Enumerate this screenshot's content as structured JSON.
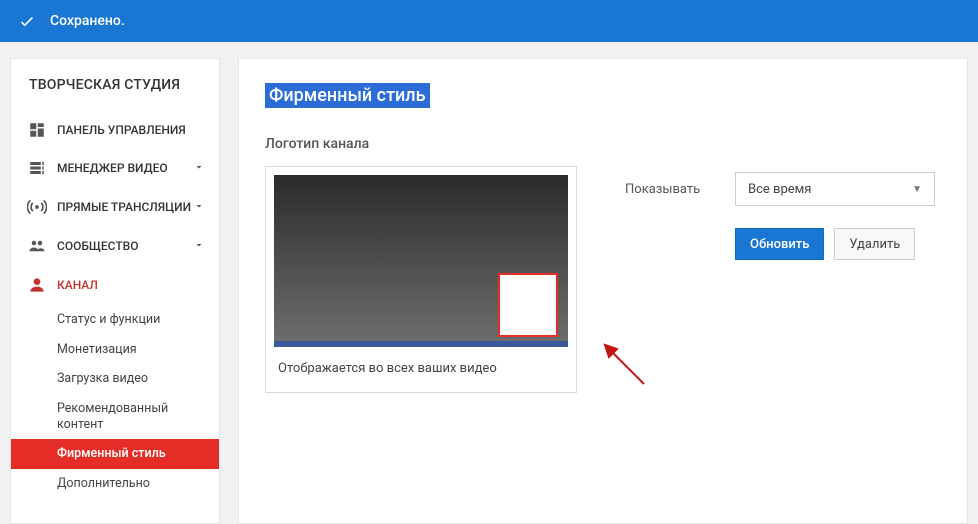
{
  "banner": {
    "text": "Сохранено."
  },
  "sidebar": {
    "title": "ТВОРЧЕСКАЯ СТУДИЯ",
    "items": [
      {
        "label": "ПАНЕЛЬ УПРАВЛЕНИЯ"
      },
      {
        "label": "МЕНЕДЖЕР ВИДЕО"
      },
      {
        "label": "ПРЯМЫЕ ТРАНСЛЯЦИИ"
      },
      {
        "label": "СООБЩЕСТВО"
      },
      {
        "label": "КАНАЛ"
      }
    ],
    "channel_sub": [
      "Статус и функции",
      "Монетизация",
      "Загрузка видео",
      "Рекомендованный контент",
      "Фирменный стиль",
      "Дополнительно"
    ]
  },
  "content": {
    "title": "Фирменный стиль",
    "section": "Логотип канала",
    "preview_caption": "Отображается во всех ваших видео",
    "show_label": "Показывать",
    "show_select": {
      "value": "Все время"
    },
    "buttons": {
      "update": "Обновить",
      "delete": "Удалить"
    }
  }
}
